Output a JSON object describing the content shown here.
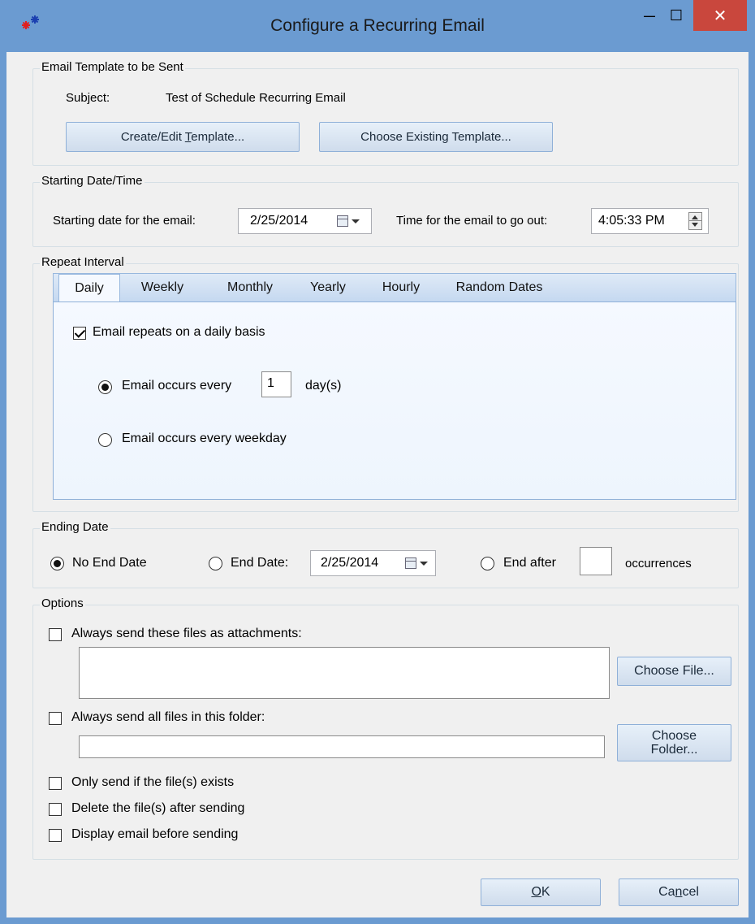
{
  "window": {
    "title": "Configure a Recurring Email",
    "close_glyph": "✕",
    "minimize_glyph": "—",
    "maximize_glyph": "☐",
    "icon": "app-snowflake-icon",
    "colors": {
      "frame": "#6b9bd1",
      "close": "#c9473d",
      "client": "#f0f0f0"
    }
  },
  "template_group": {
    "legend": "Email Template to be Sent",
    "subject_label": "Subject:",
    "subject_value": "Test of Schedule Recurring Email",
    "create_button_pre": "Create/Edit ",
    "create_button_mn": "T",
    "create_button_post": "emplate...",
    "choose_button": "Choose Existing Template..."
  },
  "start_group": {
    "legend": "Starting Date/Time",
    "date_label": "Starting date for the email:",
    "date_value": "2/25/2014",
    "time_label": "Time for the email to go out:",
    "time_value": "4:05:33 PM"
  },
  "repeat_group": {
    "legend": "Repeat Interval",
    "tabs": [
      "Daily",
      "Weekly",
      "Monthly",
      "Yearly",
      "Hourly",
      "Random Dates"
    ],
    "active_tab": "Daily",
    "daily_checkbox": "Email repeats on a daily basis",
    "daily_checked": true,
    "every_label": "Email occurs every",
    "every_value": "1",
    "every_unit": "day(s)",
    "weekday_label": "Email occurs every weekday"
  },
  "end_group": {
    "legend": "Ending Date",
    "no_end": "No End Date",
    "end_date": "End Date:",
    "end_date_value": "2/25/2014",
    "end_after": "End after",
    "occurrences_value": "",
    "occurrences": "occurrences"
  },
  "options_group": {
    "legend": "Options",
    "attach_files": "Always send these files as attachments:",
    "choose_file": "Choose File...",
    "send_folder": "Always send all files in this folder:",
    "choose_folder_1": "Choose",
    "choose_folder_2": "Folder...",
    "folder_value": "",
    "only_if_exists": "Only send if the file(s) exists",
    "delete_after": "Delete the file(s) after sending",
    "display_before": "Display email before sending"
  },
  "footer": {
    "ok_mn": "O",
    "ok_rest": "K",
    "cancel_pre": "Ca",
    "cancel_mn": "n",
    "cancel_post": "cel"
  }
}
